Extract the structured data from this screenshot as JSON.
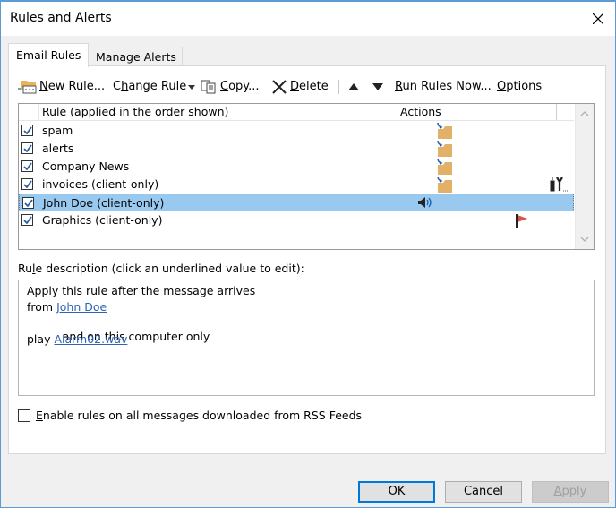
{
  "window": {
    "title": "Rules and Alerts",
    "close_icon": "close-icon"
  },
  "tabs": [
    {
      "label": "Email Rules",
      "active": true
    },
    {
      "label": "Manage Alerts",
      "active": false
    }
  ],
  "toolbar": {
    "new_rule": {
      "prefix": "",
      "accel": "N",
      "rest": "ew Rule...",
      "icon": "new-rule-icon"
    },
    "change_rule": {
      "prefix": "C",
      "accel": "h",
      "rest": "ange Rule",
      "icon": "dropdown-arrow-icon"
    },
    "copy": {
      "prefix": "",
      "accel": "C",
      "rest": "opy...",
      "icon": "copy-icon"
    },
    "delete": {
      "prefix": "",
      "accel": "D",
      "rest": "elete",
      "icon": "delete-x-icon"
    },
    "move_up_icon": "move-up-icon",
    "move_down_icon": "move-down-icon",
    "run_rules_now": {
      "prefix": "",
      "accel": "R",
      "rest": "un Rules Now..."
    },
    "options": {
      "prefix": "",
      "accel": "O",
      "rest": "ptions"
    }
  },
  "rules_list": {
    "columns": {
      "rule": "Rule (applied in the order shown)",
      "actions": "Actions"
    },
    "rows": [
      {
        "name": "spam",
        "checked": true,
        "selected": false,
        "action_icons": [
          "move-to-folder-icon"
        ]
      },
      {
        "name": "alerts",
        "checked": true,
        "selected": false,
        "action_icons": [
          "move-to-folder-icon"
        ]
      },
      {
        "name": "Company News",
        "checked": true,
        "selected": false,
        "action_icons": [
          "move-to-folder-icon"
        ]
      },
      {
        "name": "invoices  (client-only)",
        "checked": true,
        "selected": false,
        "action_icons": [
          "move-to-folder-icon",
          "custom-action-icon"
        ]
      },
      {
        "name": "John Doe  (client-only)",
        "checked": true,
        "selected": true,
        "action_icons": [
          "play-sound-icon"
        ]
      },
      {
        "name": "Graphics  (client-only)",
        "checked": true,
        "selected": false,
        "action_icons": [
          "flag-icon"
        ]
      }
    ]
  },
  "description": {
    "label_prefix": "Ru",
    "label_accel": "l",
    "label_rest": "e description (click an underlined value to edit):",
    "lines": [
      {
        "text": "Apply this rule after the message arrives",
        "link": ""
      },
      {
        "text": "from ",
        "link": "John Doe"
      },
      {
        "text": "  and on this computer only",
        "link": ""
      },
      {
        "text": "play ",
        "link": "Alarm02.wav"
      }
    ]
  },
  "rss_option": {
    "accel": "E",
    "rest": "nable rules on all messages downloaded from RSS Feeds",
    "checked": false
  },
  "buttons": {
    "ok": "OK",
    "cancel": "Cancel",
    "apply_accel": "A",
    "apply_rest": "pply"
  },
  "colors": {
    "selection": "#99c9ef",
    "link": "#2e64b4",
    "accent": "#0078d7"
  }
}
